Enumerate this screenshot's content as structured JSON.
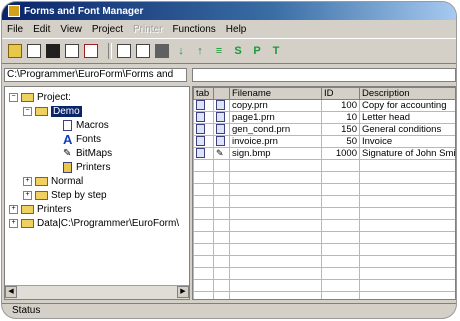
{
  "window": {
    "title": "Forms and Font Manager"
  },
  "menu": [
    {
      "label": "File",
      "enabled": true
    },
    {
      "label": "Edit",
      "enabled": true
    },
    {
      "label": "View",
      "enabled": true
    },
    {
      "label": "Project",
      "enabled": true
    },
    {
      "label": "Printer",
      "enabled": false
    },
    {
      "label": "Functions",
      "enabled": true
    },
    {
      "label": "Help",
      "enabled": true
    }
  ],
  "toolbar": {
    "icons": [
      "new-folder-icon",
      "new-document-icon",
      "save-icon",
      "open-document-icon",
      "delete-icon",
      "copy-icon",
      "properties-icon",
      "print-icon",
      "sort-ascending-icon",
      "sort-descending-icon",
      "list-icon"
    ],
    "letters": [
      "S",
      "P",
      "T"
    ]
  },
  "path": {
    "current": "C:\\Programmer\\EuroForm\\Forms and"
  },
  "tree": {
    "project": "Project:",
    "demo": "Demo",
    "macros": "Macros",
    "fonts": "Fonts",
    "bitmaps": "BitMaps",
    "printers_sub": "Printers",
    "normal": "Normal",
    "step_by_step": "Step by step",
    "printers": "Printers",
    "data": "Data|C:\\Programmer\\EuroForm\\"
  },
  "table": {
    "headers": {
      "type": "tab",
      "filename": "Filename",
      "id": "ID",
      "description": "Description"
    },
    "rows": [
      {
        "filename": "copy.prn",
        "id": "100",
        "description": "Copy for accounting"
      },
      {
        "filename": "page1.prn",
        "id": "10",
        "description": "Letter head"
      },
      {
        "filename": "gen_cond.prn",
        "id": "150",
        "description": "General conditions"
      },
      {
        "filename": "invoice.prn",
        "id": "50",
        "description": "Invoice"
      },
      {
        "filename": "sign.bmp",
        "id": "1000",
        "description": "Signature of John Smi"
      }
    ]
  },
  "status": {
    "text": "Status"
  }
}
